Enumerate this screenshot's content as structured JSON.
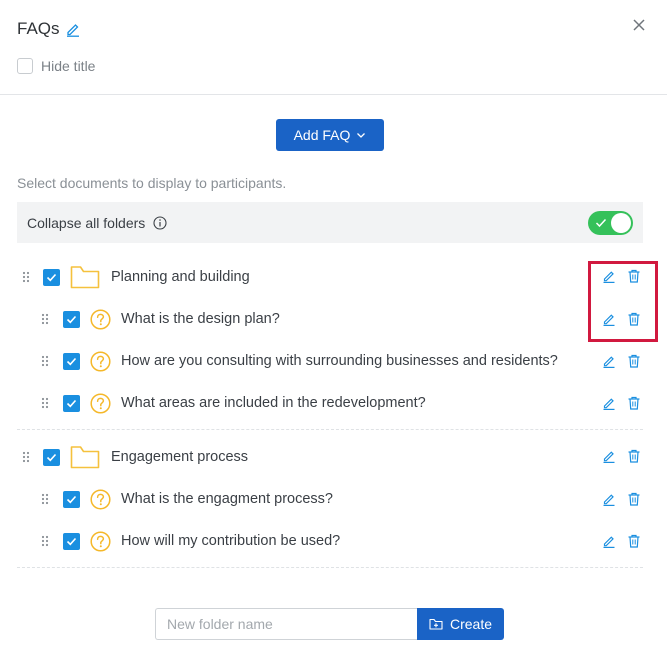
{
  "header": {
    "title": "FAQs",
    "hide_title_label": "Hide title"
  },
  "toolbar": {
    "add_faq_label": "Add FAQ"
  },
  "hint": "Select documents to display to participants.",
  "collapse": {
    "label": "Collapse all folders",
    "enabled": true
  },
  "folders": [
    {
      "label": "Planning and building",
      "checked": true,
      "items": [
        {
          "label": "What is the design plan?",
          "checked": true
        },
        {
          "label": "How are you consulting with surrounding businesses and residents?",
          "checked": true
        },
        {
          "label": "What areas are included in the redevelopment?",
          "checked": true
        }
      ]
    },
    {
      "label": "Engagement process",
      "checked": true,
      "items": [
        {
          "label": "What is the engagment process?",
          "checked": true
        },
        {
          "label": "How will my contribution be used?",
          "checked": true
        }
      ]
    }
  ],
  "new_folder": {
    "placeholder": "New folder name",
    "value": "",
    "create_label": "Create"
  },
  "colors": {
    "primary": "#1a63c6",
    "checkbox": "#1a8fe0",
    "toggle_on": "#35c15a",
    "folder": "#f5c13d",
    "question": "#f5b82a",
    "action": "#1a8fe0",
    "highlight": "#d1193f"
  },
  "icons": {
    "title_edit": "pencil-icon",
    "close": "close-icon",
    "info": "info-icon",
    "folder": "folder-icon",
    "question": "question-circle-icon",
    "edit": "pencil-icon",
    "delete": "trash-icon",
    "drag": "drag-handle-icon",
    "create": "folder-plus-icon"
  }
}
